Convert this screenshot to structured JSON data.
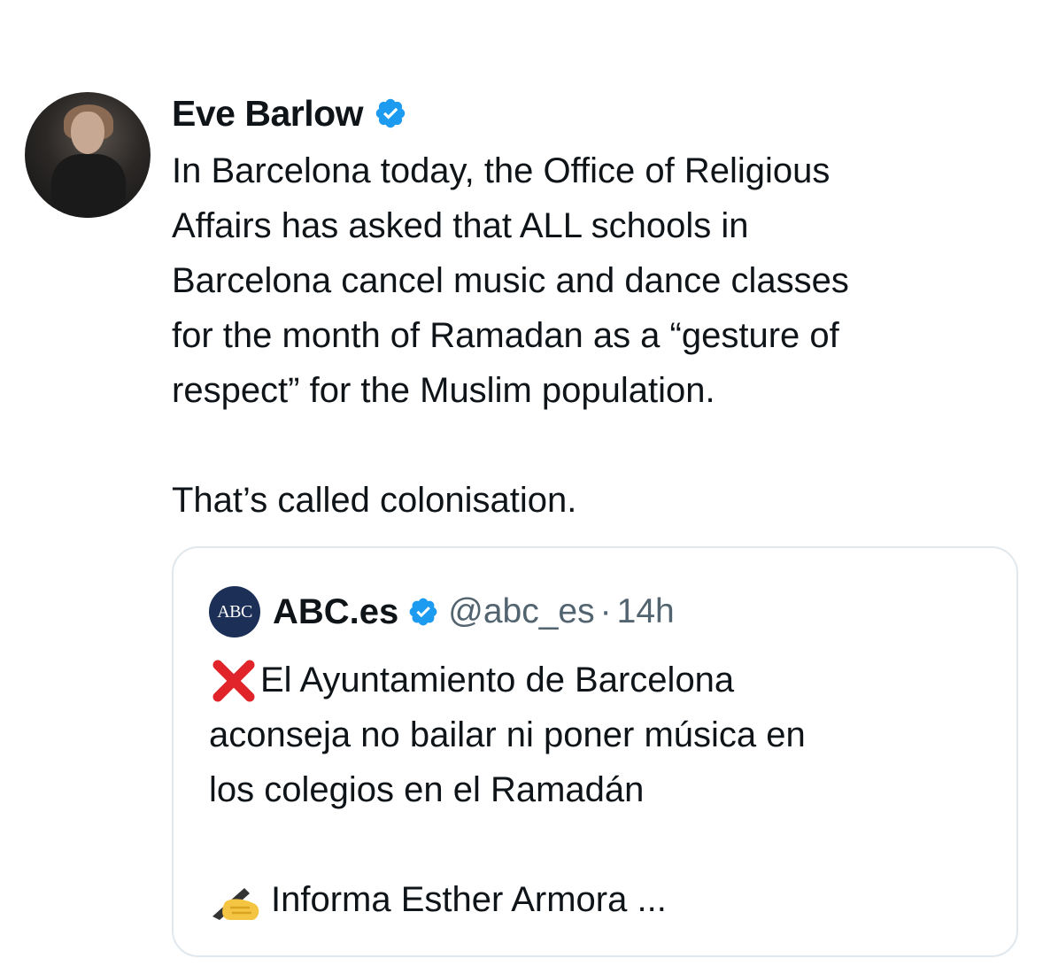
{
  "tweet": {
    "author_name": "Eve Barlow",
    "verified_icon": "verified-badge-icon",
    "body_lines": [
      "In Barcelona today, the Office of Religious",
      "Affairs has asked that ALL schools in",
      "Barcelona cancel music and dance classes",
      "for the month of Ramadan as a “gesture of",
      "respect” for the Muslim population.",
      "",
      "That’s called colonisation."
    ]
  },
  "quoted_tweet": {
    "logo_text": "ABC",
    "author_name": "ABC.es",
    "handle": "@abc_es",
    "separator": "·",
    "time": "14h",
    "line1": "El Ayuntamiento de Barcelona",
    "line2": "aconseja no bailar ni poner música en",
    "line3": "los colegios en el Ramadán",
    "line4": "Informa Esther Armora ...",
    "icons": [
      "cross-mark-icon",
      "writing-hand-icon"
    ]
  },
  "colors": {
    "verified_blue": "#1d9bf0",
    "text": "#0f1419",
    "secondary_text": "#536471",
    "border": "#e1e8ed",
    "abc_logo_bg": "#1b2f57",
    "cross_red": "#e0242a"
  }
}
